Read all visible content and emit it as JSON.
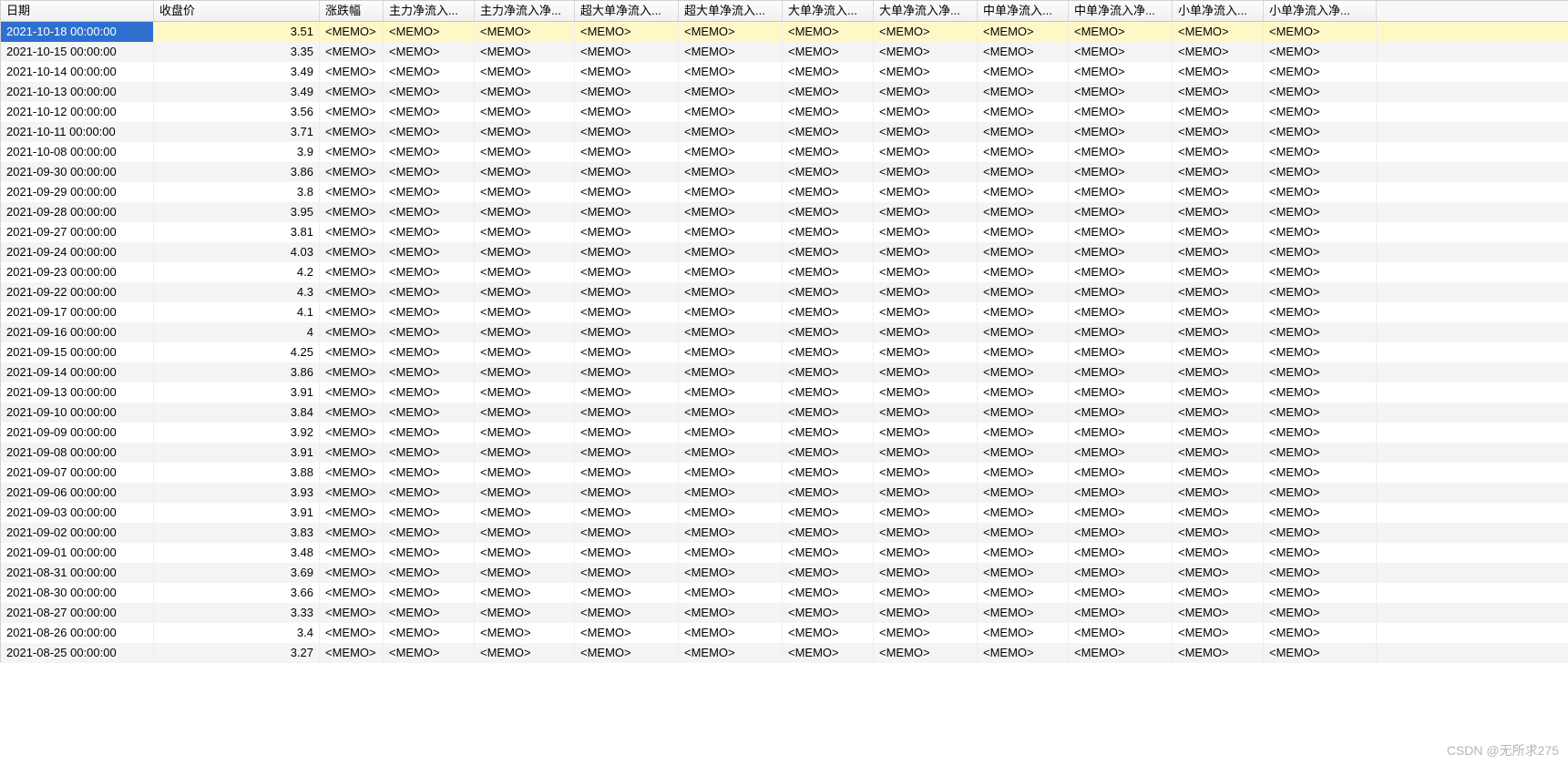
{
  "memo_text": "<MEMO>",
  "watermark": "CSDN @无所求275",
  "columns": [
    "日期",
    "收盘价",
    "涨跌幅",
    "主力净流入...",
    "主力净流入净...",
    "超大单净流入...",
    "超大单净流入...",
    "大单净流入...",
    "大单净流入净...",
    "中单净流入...",
    "中单净流入净...",
    "小单净流入...",
    "小单净流入净..."
  ],
  "selected_row_index": 0,
  "rows": [
    {
      "date": "2021-10-18 00:00:00",
      "close": "3.51"
    },
    {
      "date": "2021-10-15 00:00:00",
      "close": "3.35"
    },
    {
      "date": "2021-10-14 00:00:00",
      "close": "3.49"
    },
    {
      "date": "2021-10-13 00:00:00",
      "close": "3.49"
    },
    {
      "date": "2021-10-12 00:00:00",
      "close": "3.56"
    },
    {
      "date": "2021-10-11 00:00:00",
      "close": "3.71"
    },
    {
      "date": "2021-10-08 00:00:00",
      "close": "3.9"
    },
    {
      "date": "2021-09-30 00:00:00",
      "close": "3.86"
    },
    {
      "date": "2021-09-29 00:00:00",
      "close": "3.8"
    },
    {
      "date": "2021-09-28 00:00:00",
      "close": "3.95"
    },
    {
      "date": "2021-09-27 00:00:00",
      "close": "3.81"
    },
    {
      "date": "2021-09-24 00:00:00",
      "close": "4.03"
    },
    {
      "date": "2021-09-23 00:00:00",
      "close": "4.2"
    },
    {
      "date": "2021-09-22 00:00:00",
      "close": "4.3"
    },
    {
      "date": "2021-09-17 00:00:00",
      "close": "4.1"
    },
    {
      "date": "2021-09-16 00:00:00",
      "close": "4"
    },
    {
      "date": "2021-09-15 00:00:00",
      "close": "4.25"
    },
    {
      "date": "2021-09-14 00:00:00",
      "close": "3.86"
    },
    {
      "date": "2021-09-13 00:00:00",
      "close": "3.91"
    },
    {
      "date": "2021-09-10 00:00:00",
      "close": "3.84"
    },
    {
      "date": "2021-09-09 00:00:00",
      "close": "3.92"
    },
    {
      "date": "2021-09-08 00:00:00",
      "close": "3.91"
    },
    {
      "date": "2021-09-07 00:00:00",
      "close": "3.88"
    },
    {
      "date": "2021-09-06 00:00:00",
      "close": "3.93"
    },
    {
      "date": "2021-09-03 00:00:00",
      "close": "3.91"
    },
    {
      "date": "2021-09-02 00:00:00",
      "close": "3.83"
    },
    {
      "date": "2021-09-01 00:00:00",
      "close": "3.48"
    },
    {
      "date": "2021-08-31 00:00:00",
      "close": "3.69"
    },
    {
      "date": "2021-08-30 00:00:00",
      "close": "3.66"
    },
    {
      "date": "2021-08-27 00:00:00",
      "close": "3.33"
    },
    {
      "date": "2021-08-26 00:00:00",
      "close": "3.4"
    },
    {
      "date": "2021-08-25 00:00:00",
      "close": "3.27"
    }
  ]
}
